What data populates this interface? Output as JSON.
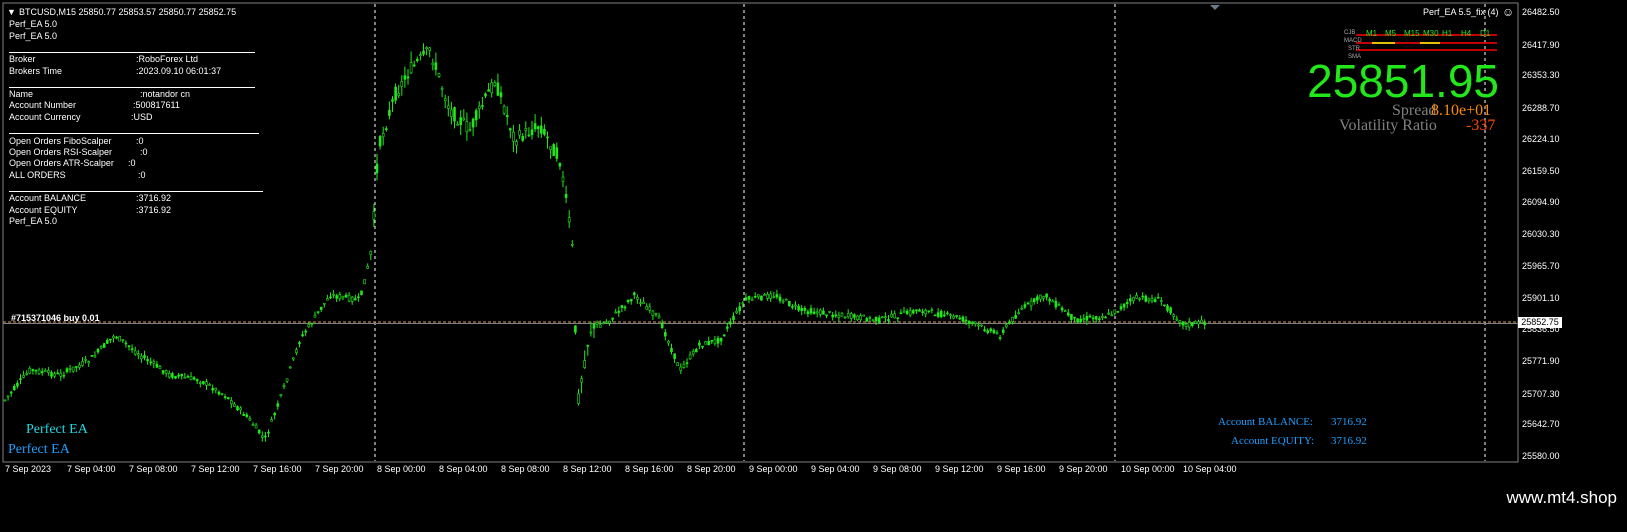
{
  "chart_header": {
    "symbol_line": "BTCUSD,M15  25850.77 25853.57 25850.77 25852.75",
    "ea_label_1": "Perf_EA 5.0",
    "ea_label_2": "Perf_EA 5.0",
    "ea_status": "Perf_EA 5.5_fix (4)"
  },
  "info_panel": {
    "broker_label": "Broker",
    "broker_value": ":RoboForex Ltd",
    "brokers_time_label": "Brokers Time",
    "brokers_time_value": ":2023.09.10 06:01:37",
    "name_label": "Name",
    "name_value": ":notandor cn",
    "account_number_label": "Account Number",
    "account_number_value": ":500817611",
    "account_currency_label": "Account Currency",
    "account_currency_value": ":USD",
    "open_fibo_label": "Open Orders FiboScalper",
    "open_fibo_value": ":0",
    "open_rsi_label": "Open Orders RSI-Scalper",
    "open_rsi_value": ":0",
    "open_atr_label": "Open Orders ATR-Scalper",
    "open_atr_value": ":0",
    "all_orders_label": "ALL ORDERS",
    "all_orders_value": ":0",
    "balance_label": "Account BALANCE",
    "balance_value": ":3716.92",
    "equity_label": "Account EQUITY",
    "equity_value": ":3716.92",
    "footer_label": "Perf_EA 5.0"
  },
  "order_line_label": "#715371046 buy 0.01",
  "current_price_tag": "25852.75",
  "big_price": "25851.95",
  "spread_label": "Spread",
  "spread_value": "8.10e+01",
  "volatility_label": "Volatility Ratio",
  "volatility_value": "-337",
  "bottom_left_1": "Perfect EA",
  "bottom_left_2": "Perfect EA",
  "bottom_right": {
    "balance_label": "Account BALANCE:",
    "balance_value": "3716.92",
    "equity_label": "Account EQUITY:",
    "equity_value": "3716.92"
  },
  "timeframes": [
    "M1",
    "M5",
    "M15",
    "M30",
    "H1",
    "H4",
    "D1"
  ],
  "indicator_rows": [
    "CJB",
    "MACD",
    "STR",
    "SMA"
  ],
  "y_axis": [
    "26482.50",
    "26417.90",
    "26353.30",
    "26288.70",
    "26224.10",
    "26159.50",
    "26094.90",
    "26030.30",
    "25965.70",
    "25901.10",
    "25836.50",
    "25771.90",
    "25707.30",
    "25642.70",
    "25580.00"
  ],
  "x_axis": [
    "7 Sep 2023",
    "7 Sep 04:00",
    "7 Sep 08:00",
    "7 Sep 12:00",
    "7 Sep 16:00",
    "7 Sep 20:00",
    "8 Sep 00:00",
    "8 Sep 04:00",
    "8 Sep 08:00",
    "8 Sep 12:00",
    "8 Sep 16:00",
    "8 Sep 20:00",
    "9 Sep 00:00",
    "9 Sep 04:00",
    "9 Sep 08:00",
    "9 Sep 12:00",
    "9 Sep 16:00",
    "9 Sep 20:00",
    "10 Sep 00:00",
    "10 Sep 04:00"
  ],
  "watermark": "www.mt4.shop",
  "colors": {
    "candle": "#22e81a",
    "order_line": "#d9a05a",
    "accent_cyan": "#1fc0ff",
    "orange": "#ff8c00"
  }
}
